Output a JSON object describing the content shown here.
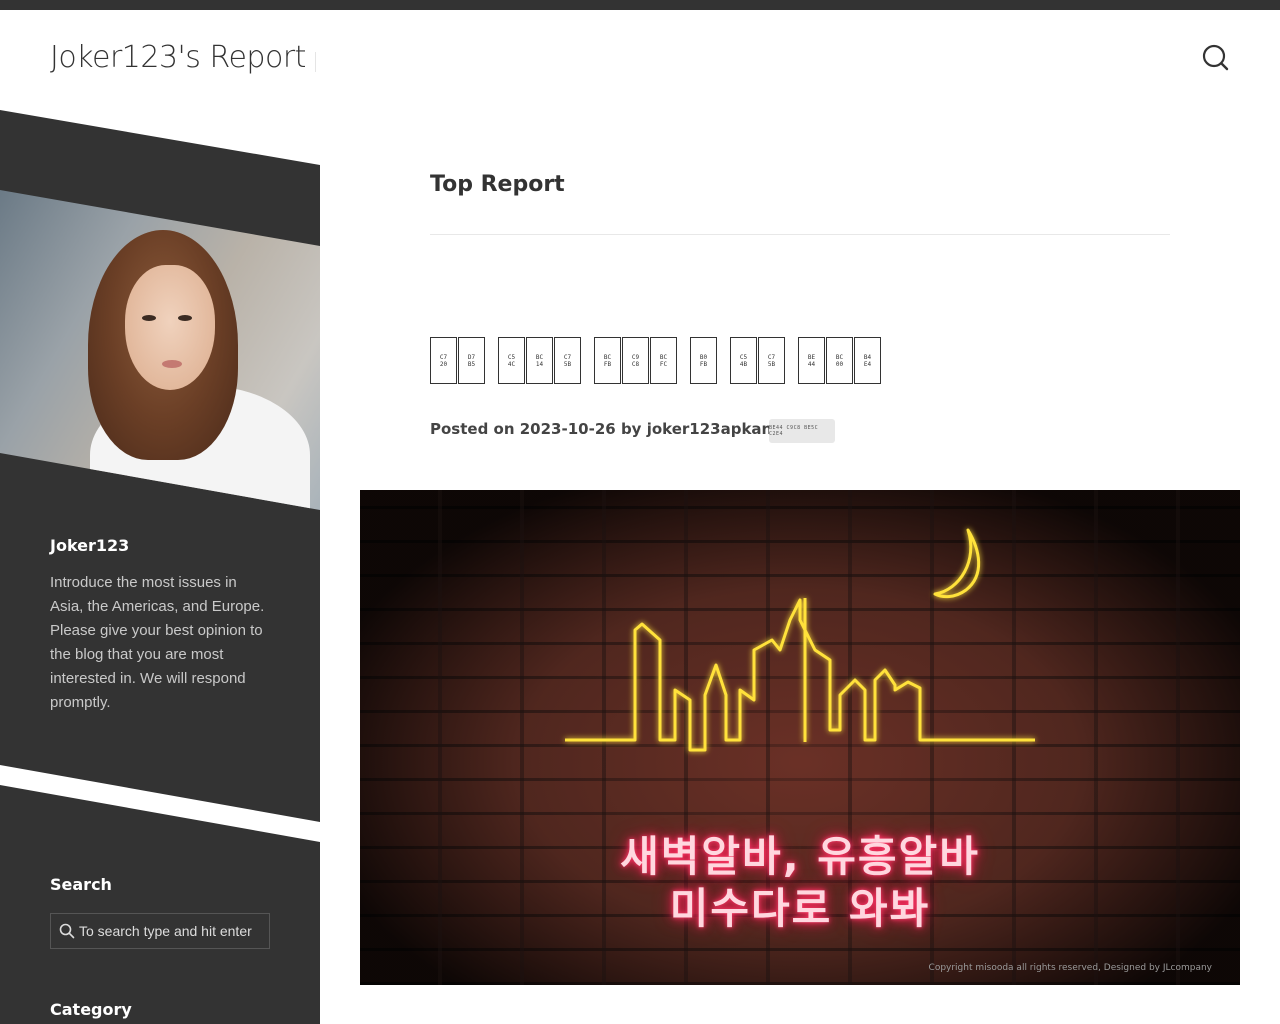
{
  "header": {
    "site_title": "Joker123's Report",
    "search_icon": "search-icon"
  },
  "sidebar": {
    "author_name": "Joker123",
    "bio": "Introduce the most issues in Asia, the Americas, and Europe. Please give your best opinion to the blog that you are most interested in. We will respond promptly.",
    "search_title": "Search",
    "search_placeholder": "To search type and hit enter",
    "category_title": "Category"
  },
  "main": {
    "page_title": "Top Report",
    "glyph_words": [
      [
        "C7\n20",
        "D7\nB5"
      ],
      [
        "C5\n4C",
        "BC\n14",
        "C7\n5B"
      ],
      [
        "BC\nFB",
        "C9\nC8",
        "BC\nFC"
      ],
      [
        "B0\nFB"
      ],
      [
        "C5\n4B",
        "C7\n5B"
      ],
      [
        "BE\n44",
        "BC\n00",
        "B4\nE4"
      ]
    ],
    "posted_prefix": "Posted on",
    "posted_date": "2023-10-26",
    "posted_by": "by",
    "author": "joker123apkandroid",
    "tag_chip": "BE44 C9C8 BE5C C2E4",
    "hero": {
      "line1": "새벽알바, 유흥알바",
      "line2": "미수다로 와봐",
      "copyright": "Copyright misooda all rights reserved, Designed by JLcompany"
    }
  },
  "colors": {
    "dark": "#333333",
    "text": "#444444",
    "neon_yellow": "#ffe23a",
    "neon_pink": "#ff2a5a"
  }
}
